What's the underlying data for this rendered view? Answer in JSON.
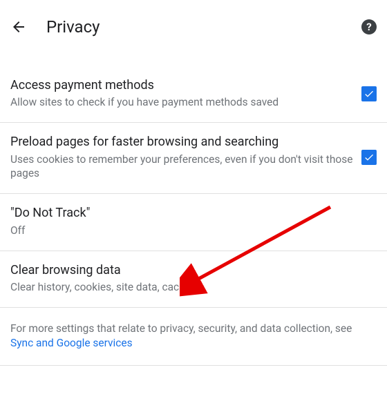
{
  "header": {
    "title": "Privacy"
  },
  "settings": [
    {
      "title": "Access payment methods",
      "subtitle": "Allow sites to check if you have payment methods saved",
      "checked": true
    },
    {
      "title": "Preload pages for faster browsing and searching",
      "subtitle": "Uses cookies to remember your preferences, even if you don't visit those pages",
      "checked": true
    },
    {
      "title": "\"Do Not Track\"",
      "subtitle": "Off",
      "checked": null
    },
    {
      "title": "Clear browsing data",
      "subtitle": "Clear history, cookies, site data, cache…",
      "checked": null
    }
  ],
  "footer": {
    "text_before": "For more settings that relate to privacy, security, and data collection, see ",
    "link_text": "Sync and Google services"
  }
}
